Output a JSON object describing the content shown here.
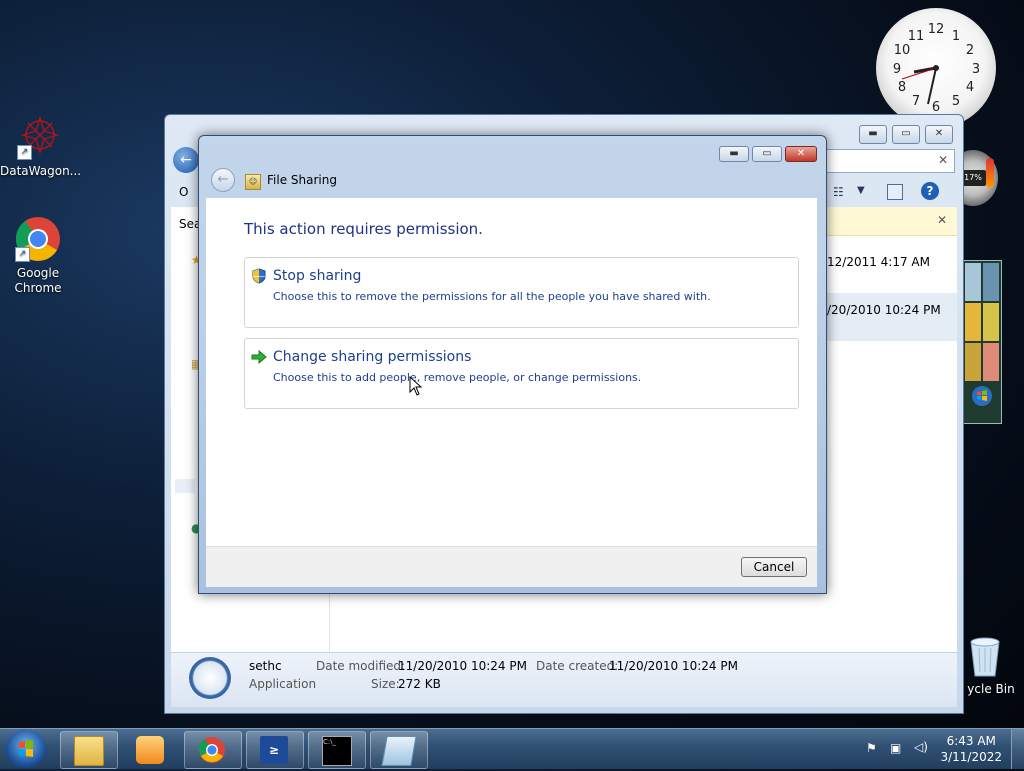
{
  "desktop": {
    "icons": [
      {
        "label": "DataWagon..."
      },
      {
        "label": "Google Chrome"
      },
      {
        "label": "ycle Bin"
      }
    ]
  },
  "explorer": {
    "left_partial": {
      "item1": "O",
      "item2": "Sea"
    },
    "rows": [
      {
        "date": "12/2011 4:17 AM"
      },
      {
        "date": "/20/2010 10:24 PM"
      }
    ],
    "details": {
      "name": "sethc",
      "type": "Application",
      "date_modified_label": "Date modified:",
      "date_modified": "11/20/2010 10:24 PM",
      "date_created_label": "Date created:",
      "date_created": "11/20/2010 10:24 PM",
      "size_label": "Size:",
      "size": "272 KB"
    }
  },
  "dialog": {
    "title": "File Sharing",
    "heading": "This action requires permission.",
    "options": [
      {
        "title": "Stop sharing",
        "desc": "Choose this to remove the permissions for all the people you have shared with."
      },
      {
        "title": "Change sharing permissions",
        "desc": "Choose this to add people, remove people, or change permissions."
      }
    ],
    "cancel_label": "Cancel"
  },
  "gadgets": {
    "cpu_percent": "17%"
  },
  "clock_numerals": [
    "12",
    "1",
    "2",
    "3",
    "4",
    "5",
    "6",
    "7",
    "8",
    "9",
    "10",
    "11"
  ],
  "taskbar": {
    "time": "6:43 AM",
    "date": "3/11/2022"
  },
  "colors": {
    "accent": "#1e3f8f",
    "taskbar": "#2f4f72"
  }
}
